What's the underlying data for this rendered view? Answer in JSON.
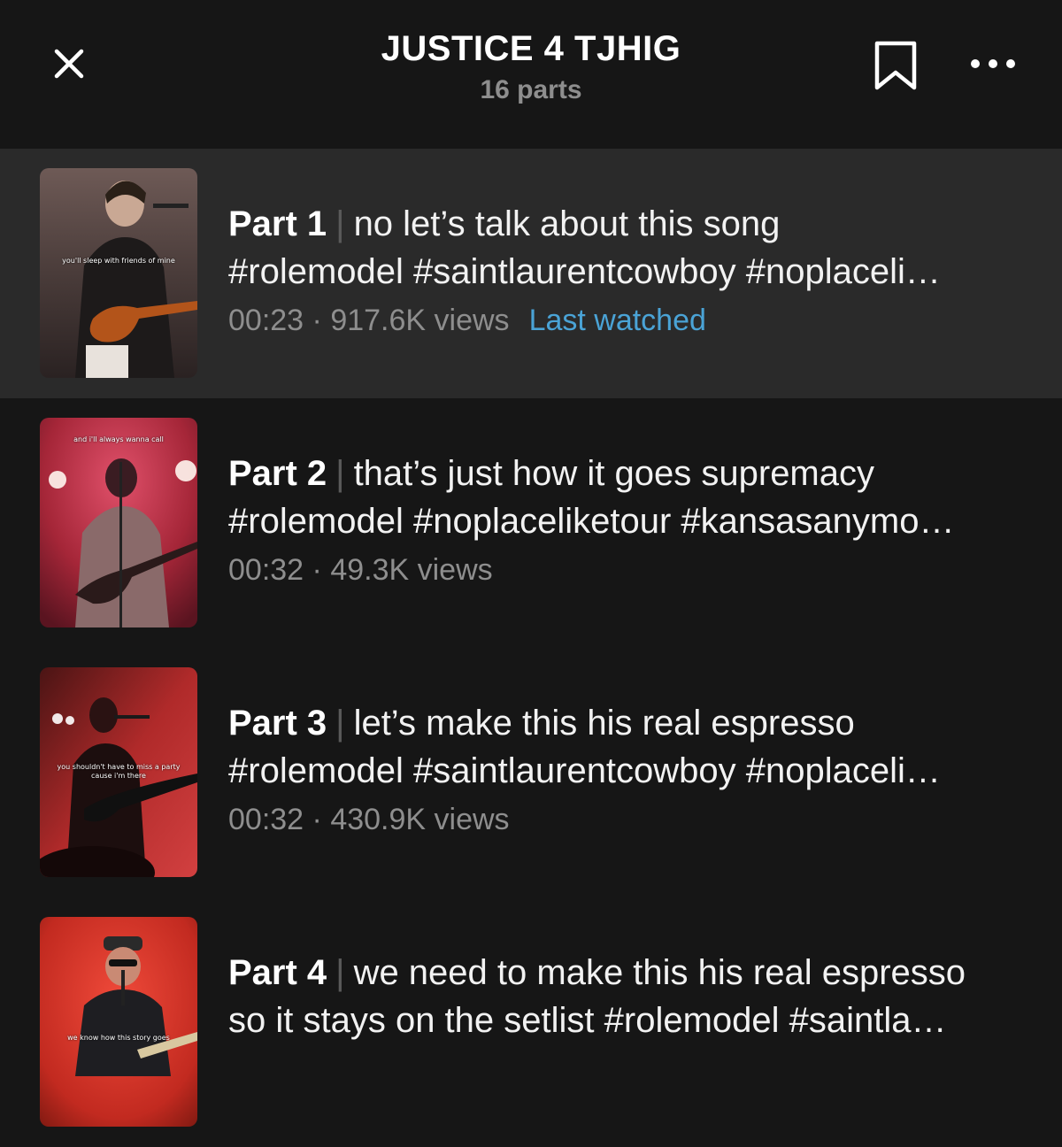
{
  "header": {
    "title": "JUSTICE 4 TJHIG",
    "subtitle": "16 parts"
  },
  "colors": {
    "background": "#161616",
    "active_row": "#2a2a2a",
    "last_watched": "#4aa3d6",
    "muted_text": "#8e8e8e"
  },
  "icons": {
    "close": "close-icon",
    "bookmark": "bookmark-icon",
    "more": "more-icon"
  },
  "parts": [
    {
      "label": "Part 1",
      "separator": "|",
      "line1": "no let’s talk about this song",
      "line2": "#rolemodel #saintlaurentcowboy #noplaceli…",
      "duration": "00:23",
      "dot": "·",
      "views": "917.6K views",
      "status": "Last watched",
      "thumb_caption": "you'll sleep with friends of mine"
    },
    {
      "label": "Part 2",
      "separator": "|",
      "line1": "that’s just how it goes supremacy",
      "line2": "#rolemodel #noplaceliketour #kansasanymo…",
      "duration": "00:32",
      "dot": "·",
      "views": "49.3K views",
      "status": "",
      "thumb_caption": "and i'll always wanna call"
    },
    {
      "label": "Part 3",
      "separator": "|",
      "line1": "let’s make this his real espresso",
      "line2": "#rolemodel #saintlaurentcowboy #noplaceli…",
      "duration": "00:32",
      "dot": "·",
      "views": "430.9K views",
      "status": "",
      "thumb_caption": "you shouldn't have to miss a party cause i'm there"
    },
    {
      "label": "Part 4",
      "separator": "|",
      "line1": "we need to make this his real espresso",
      "line2": "so it stays on the setlist #rolemodel #saintla…",
      "duration": "",
      "dot": "",
      "views": "",
      "status": "",
      "thumb_caption": "we know how this story goes"
    }
  ]
}
